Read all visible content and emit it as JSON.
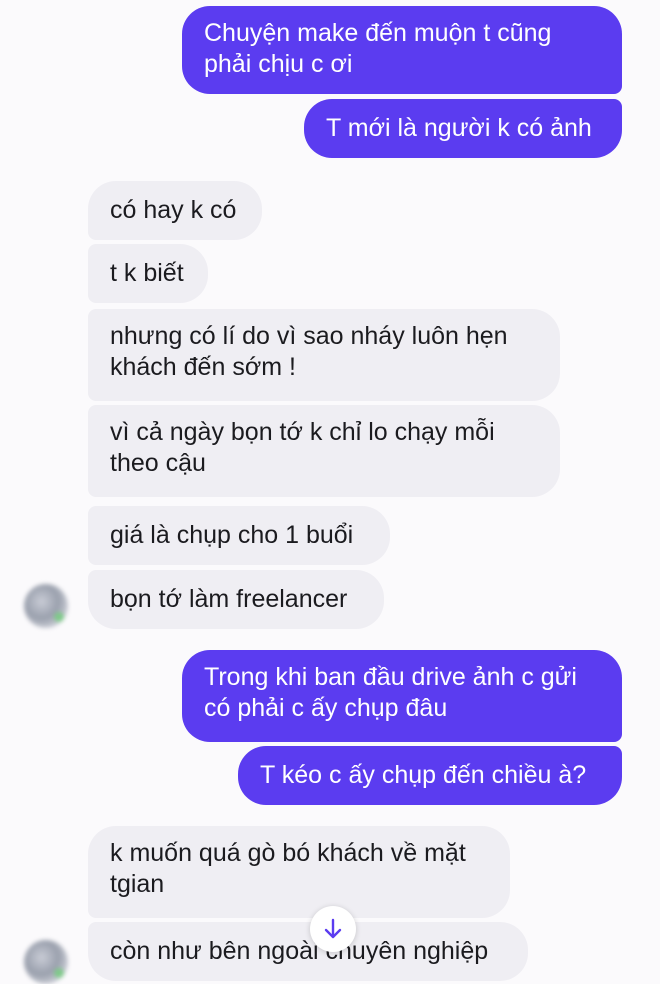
{
  "messages": [
    {
      "text": "Chuyện make đến muộn t cũng\nphải chịu c ơi"
    },
    {
      "text": "T mới là người k có ảnh"
    },
    {
      "text": "có hay k có"
    },
    {
      "text": "t k biết"
    },
    {
      "text": "nhưng có lí do vì sao nháy luôn hẹn\nkhách đến sớm !"
    },
    {
      "text": "vì cả ngày bọn tớ k chỉ lo chạy mỗi\ntheo cậu"
    },
    {
      "text": "giá là chụp cho 1 buổi"
    },
    {
      "text": "bọn tớ làm freelancer"
    },
    {
      "text": "Trong khi ban đầu drive ảnh c gửi\ncó phải c ấy chụp đâu"
    },
    {
      "text": "T kéo c ấy chụp đến chiều à?"
    },
    {
      "text": "k muốn quá gò bó khách về mặt\ntgian"
    },
    {
      "text": "còn như bên ngoài chuyên nghiệp"
    }
  ],
  "icons": {
    "avatar": "contact-avatar-blurred",
    "scroll_down": "arrow-down-icon"
  },
  "colors": {
    "outgoing_bubble": "#5b3cf0",
    "incoming_bubble": "#efeef3",
    "background": "#fbfafc"
  }
}
